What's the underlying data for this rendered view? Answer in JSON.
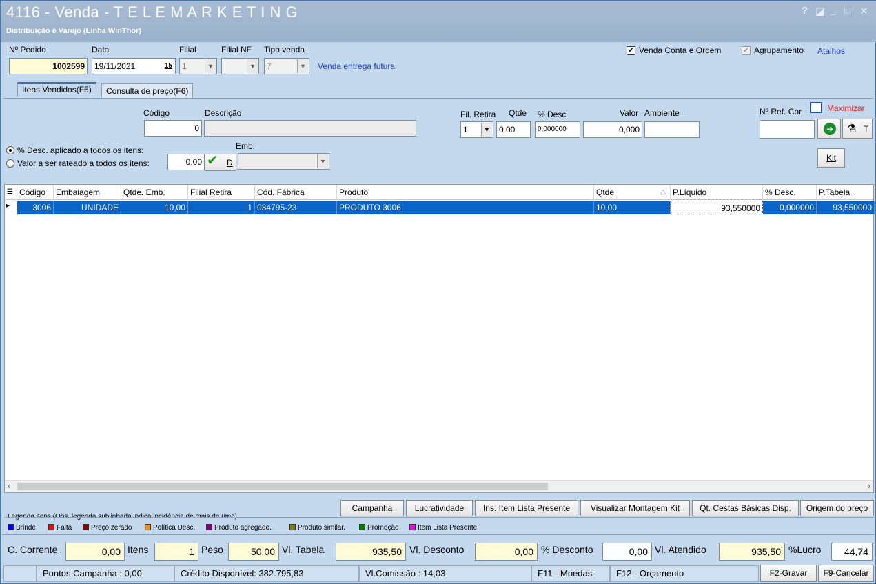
{
  "window": {
    "title": "4116 - Venda - T E L E M A R K E T I N G",
    "subtitle": "Distribuição e Varejo (Linha WinThor)",
    "controls": {
      "help": "?",
      "restore": "◪",
      "minimize": "_",
      "maximize": "□",
      "close": "✕"
    }
  },
  "header": {
    "pedido_label": "Nº Pedido",
    "pedido_value": "1002599",
    "data_label": "Data",
    "data_value": "19/11/2021",
    "calendar_glyph": "15",
    "filial_label": "Filial",
    "filial_value": "1",
    "filial_nf_label": "Filial NF",
    "filial_nf_value": "",
    "tipo_venda_label": "Tipo venda",
    "tipo_venda_value": "7",
    "tipo_venda_desc": "Venda entrega futura",
    "venda_conta_ordem_label": "Venda Conta e Ordem",
    "agrupamento_label": "Agrupamento",
    "atalhos_label": "Atalhos"
  },
  "tabs": [
    {
      "label": "Itens Vendidos(F5)",
      "active": true
    },
    {
      "label": "Consulta de preço(F6)",
      "active": false
    }
  ],
  "item_entry": {
    "codigo_label": "Código",
    "codigo_value": "0",
    "descricao_label": "Descrição",
    "descricao_value": "",
    "fil_retira_label": "Fil. Retira",
    "fil_retira_value": "1",
    "qtde_label": "Qtde",
    "qtde_value": "0,00",
    "desc_label": "% Desc",
    "desc_value": "0,000000",
    "valor_label": "Valor",
    "valor_value": "0,000",
    "ambiente_label": "Ambiente",
    "ambiente_value": "",
    "ref_cor_label": "Nº Ref. Cor",
    "ref_cor_value": "",
    "maximizar_label": "Maximizar",
    "t_label": "T",
    "kit_label": "Kit"
  },
  "discount": {
    "opt1_label": "% Desc. aplicado a todos os itens:",
    "opt2_label": "Valor a ser rateado a todos os itens:",
    "value": "0,00",
    "d_label": "D",
    "emb_label": "Emb.",
    "emb_value": ""
  },
  "grid": {
    "columns": [
      "Código",
      "Embalagem",
      "Qtde. Emb.",
      "Filial Retira",
      "Cód. Fábrica",
      "Produto",
      "Qtde",
      "P.Líquido",
      "% Desc.",
      "P.Tabela"
    ],
    "rows": [
      {
        "codigo": "3006",
        "embalagem": "UNIDADE",
        "qtde_emb": "10,00",
        "filial_retira": "1",
        "cod_fabrica": "034795-23",
        "produto": "PRODUTO 3006",
        "qtde": "10,00",
        "p_liquido": "93,550000",
        "desc": "0,000000",
        "p_tabela": "93,550000"
      }
    ]
  },
  "action_buttons": [
    "Campanha",
    "Lucratividade",
    "Ins. Item Lista Presente",
    "Visualizar Montagem Kit",
    "Qt. Cestas Básicas Disp.",
    "Origem do preço"
  ],
  "legend": {
    "title": "Legenda itens (Obs. legenda sublinhada indica incidência de mais de uma)",
    "items": [
      {
        "label": "Brinde",
        "color": "#0000ff"
      },
      {
        "label": "Falta",
        "color": "#ff0000"
      },
      {
        "label": "Preço zerado",
        "color": "#8b0000"
      },
      {
        "label": "Política Desc.",
        "color": "#ff8c00"
      },
      {
        "label": "Produto agregado.",
        "color": "#800080"
      },
      {
        "label": "Produto similar.",
        "color": "#808000"
      },
      {
        "label": "Promoção",
        "color": "#008000"
      },
      {
        "label": "Item Lista Presente",
        "color": "#ff00ff"
      }
    ]
  },
  "totals": {
    "c_corrente_label": "C. Corrente",
    "c_corrente": "0,00",
    "itens_label": "Itens",
    "itens": "1",
    "peso_label": "Peso",
    "peso": "50,00",
    "vl_tabela_label": "Vl. Tabela",
    "vl_tabela": "935,50",
    "vl_desconto_label": "Vl. Desconto",
    "vl_desconto": "0,00",
    "pct_desconto_label": "% Desconto",
    "pct_desconto": "0,00",
    "vl_atendido_label": "Vl. Atendido",
    "vl_atendido": "935,50",
    "lucro_label": "%Lucro",
    "lucro": "44,74"
  },
  "status": {
    "pontos": "Pontos Campanha : 0,00",
    "credito": "Crédito Disponível: 382.795,83",
    "comissao": "Vl.Comissão : 14,03",
    "f11": "F11 - Moedas",
    "f12": "F12 - Orçamento",
    "gravar": "F2-Gravar",
    "cancelar": "F9-Cancelar"
  }
}
